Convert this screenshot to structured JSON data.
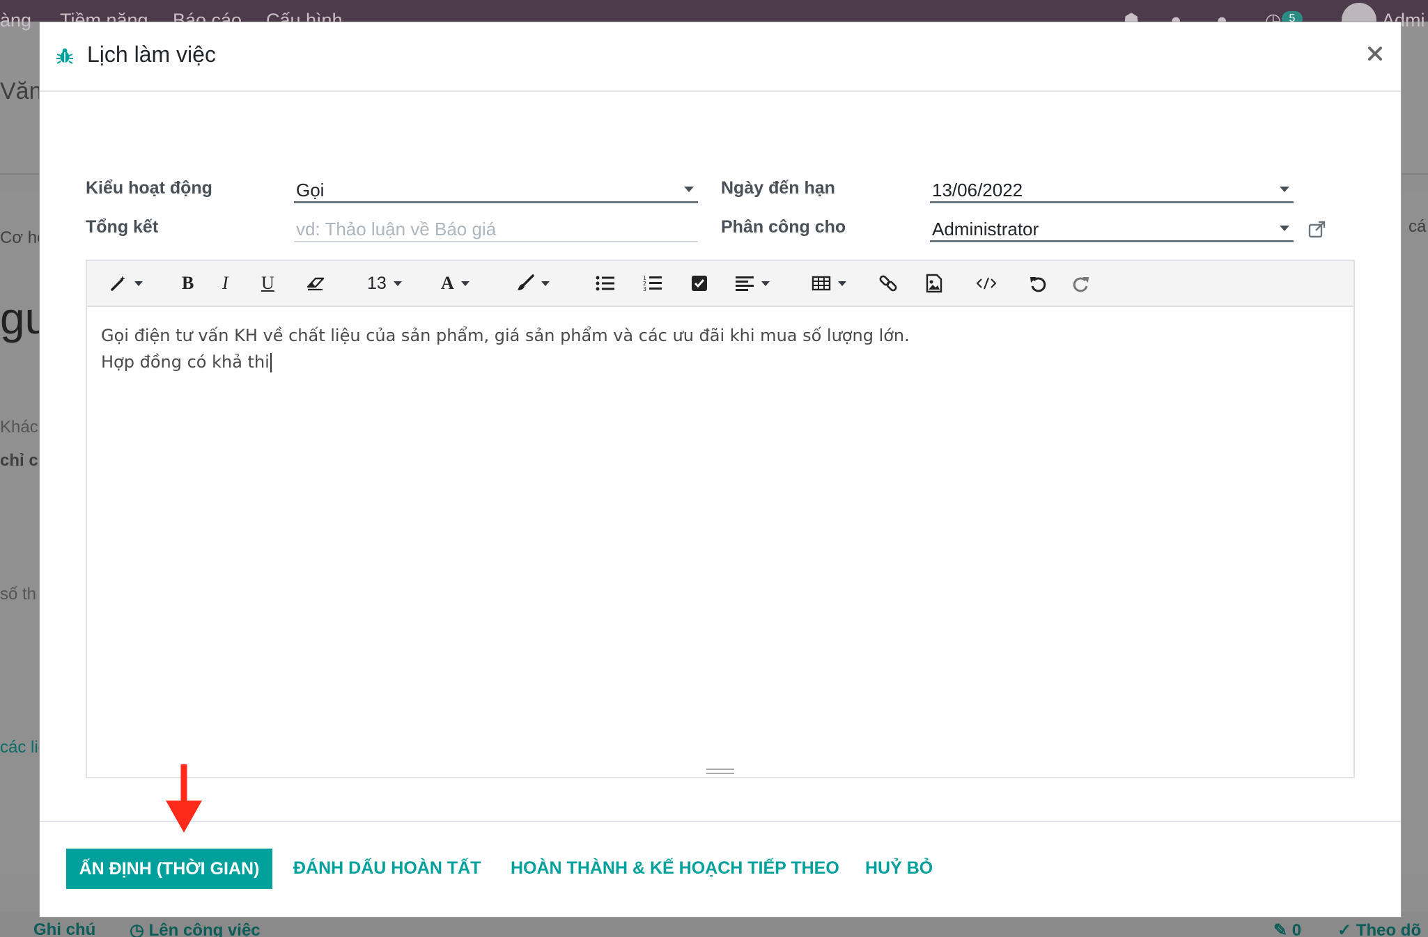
{
  "background": {
    "nav_items": [
      "àng",
      "Tiềm năng",
      "Báo cáo",
      "Cấu hình"
    ],
    "notification_count": "5",
    "user_partial": "Admi",
    "left_fragments": [
      "Văn",
      "Cơ hộ",
      "gu",
      "Khác",
      "chỉ c",
      "số th",
      "các liê"
    ],
    "right_fragment": "cá",
    "chatter": {
      "note_label": "Ghi chú",
      "schedule_label": "Lên công việc",
      "attachments_count": "0",
      "follow_label": "Theo dõ"
    }
  },
  "modal": {
    "title": "Lịch làm việc",
    "fields": {
      "activity_type": {
        "label": "Kiểu hoạt động",
        "value": "Gọi"
      },
      "summary": {
        "label": "Tổng kết",
        "placeholder": "vd: Thảo luận về Báo giá"
      },
      "due_date": {
        "label": "Ngày đến hạn",
        "value": "13/06/2022"
      },
      "assigned_to": {
        "label": "Phân công cho",
        "value": "Administrator"
      }
    },
    "toolbar": {
      "font_size": "13",
      "font_color_glyph": "A",
      "bold_glyph": "B",
      "italic_glyph": "I",
      "underline_glyph": "U"
    },
    "note": {
      "line1": "Gọi điện tư vấn KH về chất liệu của sản phẩm, giá sản phẩm và các ưu đãi khi mua số lượng lớn.",
      "line2": "Hợp đồng có khả thi"
    },
    "footer": {
      "schedule_button": "ẤN ĐỊNH (THỜI GIAN)",
      "mark_done_button": "ĐÁNH DẤU HOÀN TẤT",
      "done_schedule_next_button": "HOÀN THÀNH & KẾ HOẠCH TIẾP THEO",
      "discard_button": "HUỶ BỎ"
    }
  },
  "colors": {
    "accent": "#00a09d",
    "navbar": "#4d3a4a",
    "annotation_arrow": "#ff2a1a"
  }
}
